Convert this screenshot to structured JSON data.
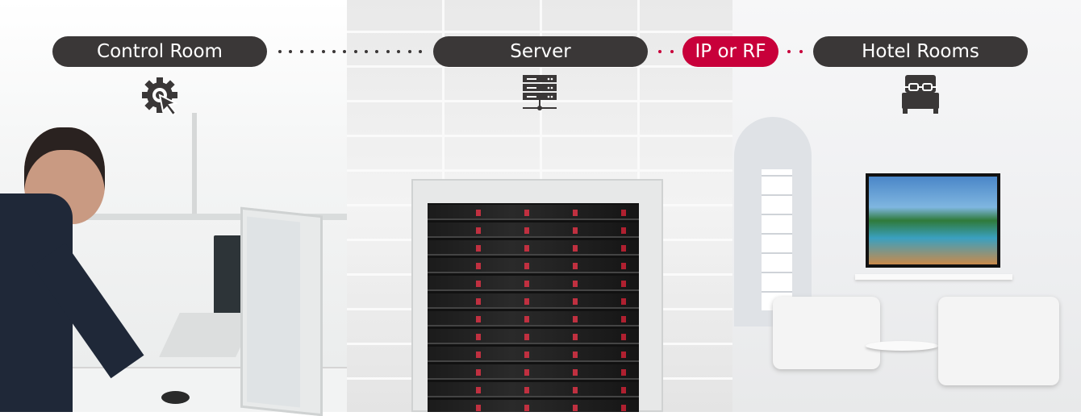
{
  "nodes": [
    {
      "label": "Control Room",
      "icon": "gear-cursor-icon"
    },
    {
      "label": "Server",
      "icon": "server-network-icon"
    },
    {
      "label": "Hotel Rooms",
      "icon": "bed-icon"
    }
  ],
  "connector": {
    "label": "IP or RF"
  },
  "colors": {
    "pill": "#3a3737",
    "accent": "#c8003a"
  }
}
